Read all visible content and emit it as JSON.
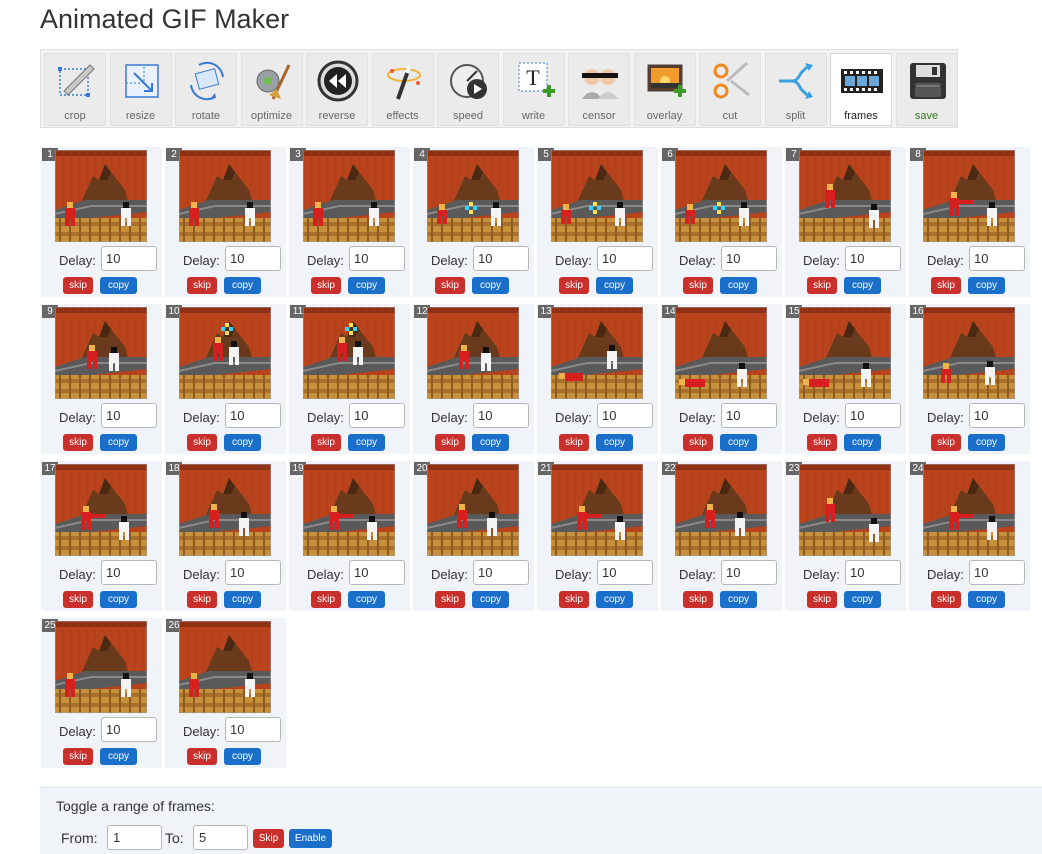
{
  "page": {
    "title": "Animated GIF Maker"
  },
  "toolbar": [
    {
      "key": "crop",
      "label": "crop",
      "icon": "crop-icon"
    },
    {
      "key": "resize",
      "label": "resize",
      "icon": "resize-icon"
    },
    {
      "key": "rotate",
      "label": "rotate",
      "icon": "rotate-icon"
    },
    {
      "key": "optimize",
      "label": "optimize",
      "icon": "optimize-icon"
    },
    {
      "key": "reverse",
      "label": "reverse",
      "icon": "reverse-icon"
    },
    {
      "key": "effects",
      "label": "effects",
      "icon": "effects-icon"
    },
    {
      "key": "speed",
      "label": "speed",
      "icon": "speed-icon"
    },
    {
      "key": "write",
      "label": "write",
      "icon": "write-icon"
    },
    {
      "key": "censor",
      "label": "censor",
      "icon": "censor-icon"
    },
    {
      "key": "overlay",
      "label": "overlay",
      "icon": "overlay-icon"
    },
    {
      "key": "cut",
      "label": "cut",
      "icon": "cut-icon"
    },
    {
      "key": "split",
      "label": "split",
      "icon": "split-icon"
    },
    {
      "key": "frames",
      "label": "frames",
      "icon": "film-strip-icon",
      "active": true
    },
    {
      "key": "save",
      "label": "save",
      "icon": "floppy-disk-icon"
    }
  ],
  "frame_labels": {
    "delay": "Delay:",
    "skip": "skip",
    "copy": "copy"
  },
  "frames": [
    {
      "n": "1",
      "delay": "10",
      "pose": "stand"
    },
    {
      "n": "2",
      "delay": "10",
      "pose": "stand"
    },
    {
      "n": "3",
      "delay": "10",
      "pose": "stand"
    },
    {
      "n": "4",
      "delay": "10",
      "pose": "hit"
    },
    {
      "n": "5",
      "delay": "10",
      "pose": "hit"
    },
    {
      "n": "6",
      "delay": "10",
      "pose": "hit"
    },
    {
      "n": "7",
      "delay": "10",
      "pose": "jump"
    },
    {
      "n": "8",
      "delay": "10",
      "pose": "kick"
    },
    {
      "n": "9",
      "delay": "10",
      "pose": "grab"
    },
    {
      "n": "10",
      "delay": "10",
      "pose": "spark"
    },
    {
      "n": "11",
      "delay": "10",
      "pose": "spark"
    },
    {
      "n": "12",
      "delay": "10",
      "pose": "grab"
    },
    {
      "n": "13",
      "delay": "10",
      "pose": "fall"
    },
    {
      "n": "14",
      "delay": "10",
      "pose": "down"
    },
    {
      "n": "15",
      "delay": "10",
      "pose": "down"
    },
    {
      "n": "16",
      "delay": "10",
      "pose": "rise"
    },
    {
      "n": "17",
      "delay": "10",
      "pose": "kick"
    },
    {
      "n": "18",
      "delay": "10",
      "pose": "stand2"
    },
    {
      "n": "19",
      "delay": "10",
      "pose": "kick"
    },
    {
      "n": "20",
      "delay": "10",
      "pose": "stand2"
    },
    {
      "n": "21",
      "delay": "10",
      "pose": "kick"
    },
    {
      "n": "22",
      "delay": "10",
      "pose": "stand2"
    },
    {
      "n": "23",
      "delay": "10",
      "pose": "jump"
    },
    {
      "n": "24",
      "delay": "10",
      "pose": "kick"
    },
    {
      "n": "25",
      "delay": "10",
      "pose": "stand"
    },
    {
      "n": "26",
      "delay": "10",
      "pose": "stand"
    }
  ],
  "range": {
    "title": "Toggle a range of frames:",
    "from_label": "From:",
    "from_value": "1",
    "to_label": "To:",
    "to_value": "5",
    "skip_label": "Skip",
    "enable_label": "Enable"
  },
  "colors": {
    "skip": "#c9302c",
    "copy": "#1a6fca",
    "frame_bg": "#f0f3f7",
    "scene_sky": "#b8431c",
    "scene_floor": "#c7903a"
  }
}
